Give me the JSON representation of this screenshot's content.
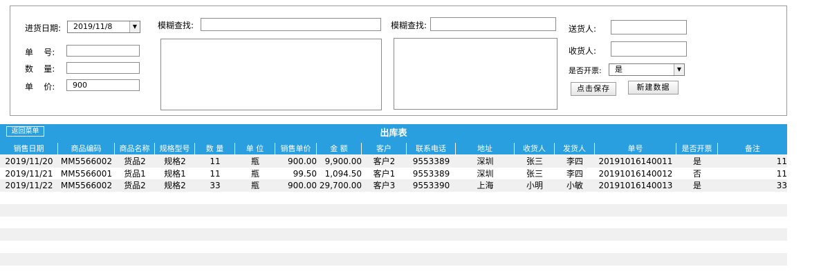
{
  "form": {
    "purchase_date_label": "进货日期:",
    "purchase_date_value": "2019/11/8",
    "order_no_label": "单    号:",
    "quantity_label": "数    量:",
    "price_label": "单    价:",
    "price_value": "900",
    "fuzzy1_label": "模糊查找:",
    "fuzzy2_label": "模糊查找:",
    "sender_label": "送货人:",
    "receiver_label": "收货人:",
    "invoice_label": "是否开票:",
    "invoice_value": "是",
    "save_button": "点击保存",
    "new_button": "新建数据"
  },
  "table": {
    "title": "出库表",
    "back_button": "返回菜单",
    "headers": [
      "销售日期",
      "商品编码",
      "商品名称",
      "规格型号",
      "数  量",
      "单  位",
      "销售单价",
      "金  额",
      "客户",
      "联系电话",
      "地址",
      "收货人",
      "发货人",
      "单号",
      "是否开票",
      "备注"
    ],
    "rows": [
      [
        "2019/11/20",
        "MM5566002",
        "货品2",
        "规格2",
        "11",
        "瓶",
        "900.00",
        "9,900.00",
        "客户2",
        "9553389",
        "深圳",
        "张三",
        "李四",
        "20191016140011",
        "是",
        "11"
      ],
      [
        "2019/11/21",
        "MM5566001",
        "货品1",
        "规格1",
        "11",
        "瓶",
        "99.50",
        "1,094.50",
        "客户1",
        "9553389",
        "深圳",
        "张三",
        "李四",
        "20191016140012",
        "否",
        "11"
      ],
      [
        "2019/11/22",
        "MM5566002",
        "货品2",
        "规格2",
        "33",
        "瓶",
        "900.00",
        "29,700.00",
        "客户3",
        "9553390",
        "上海",
        "小明",
        "小敏",
        "20191016140013",
        "是",
        "33"
      ]
    ]
  }
}
